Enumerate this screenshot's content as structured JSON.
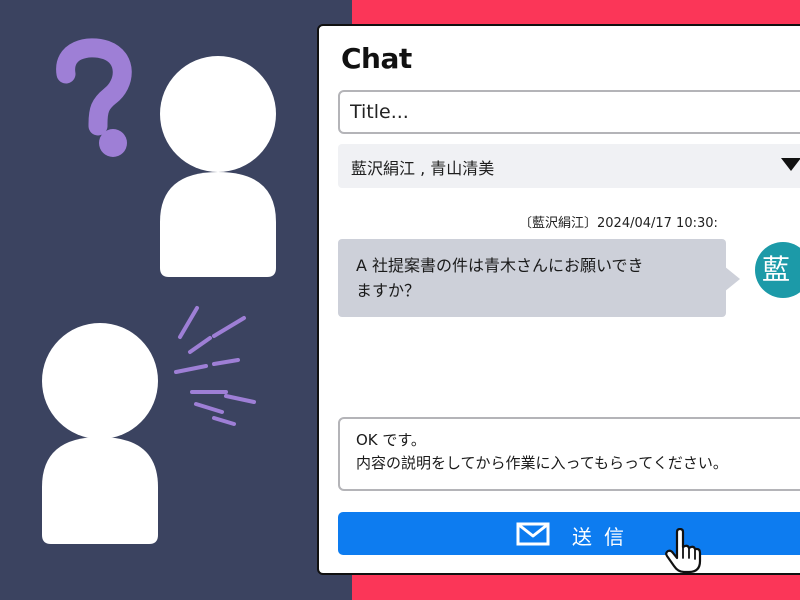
{
  "chat": {
    "title": "Chat",
    "title_placeholder": "Title...",
    "recipients_value": "藍沢絹江 , 青山清美",
    "message": {
      "meta": "〔藍沢絹江〕2024/04/17 10:30:",
      "text": "A 社提案書の件は青木さんにお願いできますか？",
      "avatar_initial": "藍"
    },
    "reply_text": "OK です。\n内容の説明をしてから作業に入ってもらってください。",
    "send_label": "送信"
  },
  "colors": {
    "bg_left": "#3b4360",
    "bg_right": "#fb3658",
    "accent_blue": "#0d7cf0",
    "avatar_teal": "#1c9aa8",
    "bubble_gray": "#cdd0d9",
    "question_purple": "#9e7fd6"
  },
  "icons": {
    "question": "question-mark-icon",
    "speech": "speech-lines-icon",
    "dropdown": "triangle-down-icon",
    "send": "envelope-icon",
    "cursor": "hand-pointer-icon"
  }
}
